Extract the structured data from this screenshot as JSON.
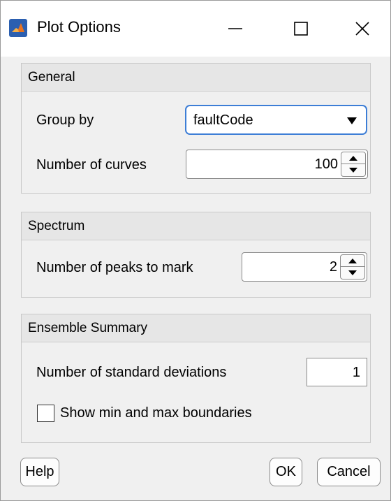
{
  "window": {
    "title": "Plot Options",
    "minimize_icon": "minimize-icon",
    "maximize_icon": "maximize-icon",
    "close_icon": "close-icon",
    "app_icon": "matlab-icon"
  },
  "general": {
    "header": "General",
    "group_by_label": "Group by",
    "group_by_value": "faultCode",
    "num_curves_label": "Number of curves",
    "num_curves_value": "100"
  },
  "spectrum": {
    "header": "Spectrum",
    "num_peaks_label": "Number of peaks to mark",
    "num_peaks_value": "2"
  },
  "ensemble": {
    "header": "Ensemble Summary",
    "num_std_label": "Number of standard deviations",
    "num_std_value": "1",
    "show_bounds_label": "Show min and max boundaries",
    "show_bounds_checked": false
  },
  "footer": {
    "help_label": "Help",
    "ok_label": "OK",
    "cancel_label": "Cancel"
  },
  "colors": {
    "accent": "#3d7ed6",
    "panel_header": "#e6e6e6",
    "window_bg": "#f0f0f0"
  }
}
